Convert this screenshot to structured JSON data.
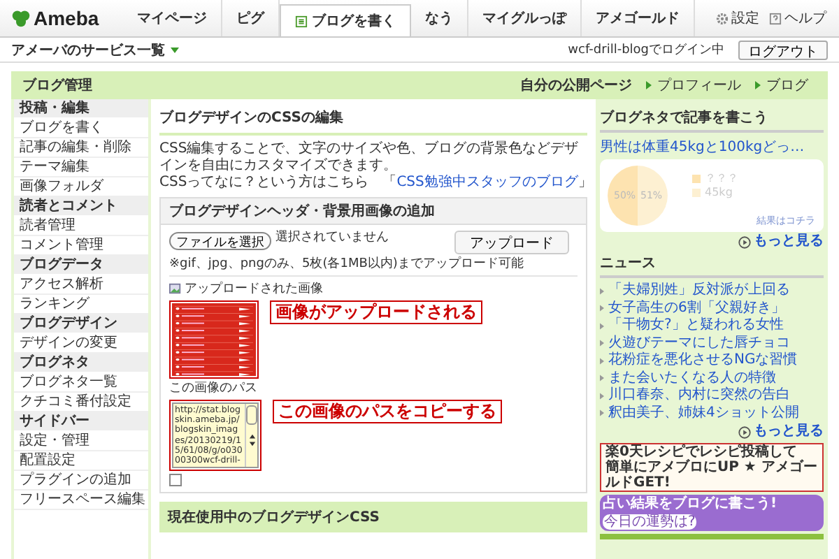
{
  "header": {
    "logo": "Ameba",
    "tabs": [
      {
        "label": "マイページ",
        "selected": false,
        "icon": false
      },
      {
        "label": "ピグ",
        "selected": false,
        "icon": false
      },
      {
        "label": "ブログを書く",
        "selected": true,
        "icon": true
      },
      {
        "label": "なう",
        "selected": false,
        "icon": false
      },
      {
        "label": "マイグルっぽ",
        "selected": false,
        "icon": false
      },
      {
        "label": "アメゴールド",
        "selected": false,
        "icon": false
      }
    ],
    "settings": "設定",
    "help": "ヘルプ"
  },
  "subnav": {
    "services": "アメーバのサービス一覧",
    "login": "wcf-drill-blogでログイン中",
    "logout": "ログアウト"
  },
  "admin_bar": {
    "title": "ブログ管理",
    "public_page": "自分の公開ページ",
    "links": [
      "プロフィール",
      "ブログ"
    ]
  },
  "sidebar": {
    "sections": [
      {
        "title": "投稿・編集",
        "items": [
          "ブログを書く",
          "記事の編集・削除",
          "テーマ編集",
          "画像フォルダ"
        ]
      },
      {
        "title": "読者とコメント",
        "items": [
          "読者管理",
          "コメント管理"
        ]
      },
      {
        "title": "ブログデータ",
        "items": [
          "アクセス解析",
          "ランキング"
        ]
      },
      {
        "title": "ブログデザイン",
        "items": [
          "デザインの変更"
        ]
      },
      {
        "title": "ブログネタ",
        "items": [
          "ブログネタ一覧",
          "クチコミ番付設定"
        ]
      },
      {
        "title": "サイドバー",
        "items": [
          "設定・管理",
          "配置設定",
          "プラグインの追加",
          "フリースペース編集"
        ]
      }
    ]
  },
  "main": {
    "title": "ブログデザインのCSSの編集",
    "description": "CSS編集することで、文字のサイズや色、ブログの背景色などデザインを自由にカスタマイズできます。",
    "help_text": "CSSってなに？という方はこちら　「",
    "help_link": "CSS勉強中スタッフのブログ",
    "help_end": "」",
    "upload_box": {
      "title": "ブログデザインヘッダ・背景用画像の追加",
      "file_button": "ファイルを選択",
      "file_status": "選択されていません",
      "upload_button": "アップロード",
      "note": "※gif、jpg、pngのみ、5枚(各1MB以内)までアップロード可能",
      "uploaded_label": "アップロードされた画像",
      "path_label": "この画像のパス",
      "path_value": "http://stat.blogskin.ameba.jp/blogskin_images/20130219/15/61/08/g/o03000300wcf-drill-",
      "checked": false
    },
    "annotations": [
      "画像がアップロードされる",
      "この画像のパスをコピーする"
    ],
    "current_css_title": "現在使用中のブログデザインCSS"
  },
  "right": {
    "neta": {
      "title": "ブログネタで記事を書こう",
      "question": "男性は体重45kgと100kgどっ…",
      "legend": [
        {
          "label": "？？？",
          "color": "#fde3b0"
        },
        {
          "label": "45kg",
          "color": "#fdf0d2"
        }
      ],
      "slice_labels": [
        "50%",
        "51%"
      ],
      "result_link": "結果はコチラ",
      "more": "もっと見る"
    },
    "news": {
      "title": "ニュース",
      "items": [
        "「夫婦別姓」反対派が上回る",
        "女子高生の6割「父親好き」",
        "「干物女?」と疑われる女性",
        "火遊びテーマにした唇チョコ",
        "花粉症を悪化させるNGな習慣",
        "また会いたくなる人の特徴",
        "川口春奈、内村に突然の告白",
        "釈由美子、姉妹4ショット公開"
      ],
      "more": "もっと見る"
    },
    "banners": {
      "recipe_line1": "楽0天レシピでレシピ投稿して",
      "recipe_line2": "簡単にアメブロにUP ★ アメゴールドGET!",
      "fortune": "占い結果をブログに書こう!",
      "fortune_badge": "今日の運勢は?"
    }
  }
}
